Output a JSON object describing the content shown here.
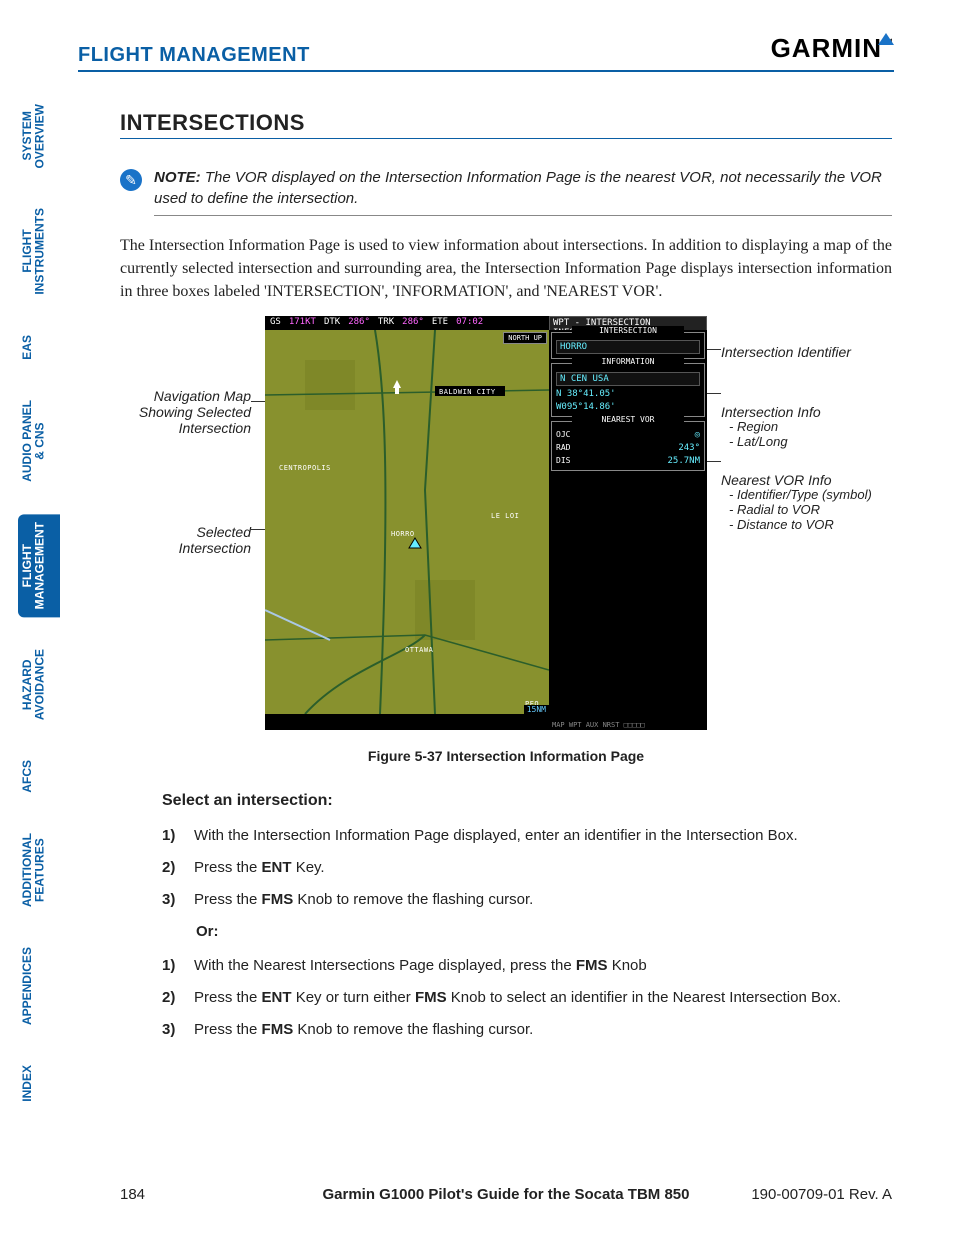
{
  "header": {
    "section": "FLIGHT MANAGEMENT",
    "brand": "GARMIN",
    "tm": "™"
  },
  "tabs": [
    {
      "label": "SYSTEM\nOVERVIEW",
      "active": false
    },
    {
      "label": "FLIGHT\nINSTRUMENTS",
      "active": false
    },
    {
      "label": "EAS",
      "active": false
    },
    {
      "label": "AUDIO PANEL\n& CNS",
      "active": false
    },
    {
      "label": "FLIGHT\nMANAGEMENT",
      "active": true
    },
    {
      "label": "HAZARD\nAVOIDANCE",
      "active": false
    },
    {
      "label": "AFCS",
      "active": false
    },
    {
      "label": "ADDITIONAL\nFEATURES",
      "active": false
    },
    {
      "label": "APPENDICES",
      "active": false
    },
    {
      "label": "INDEX",
      "active": false
    }
  ],
  "heading": "INTERSECTIONS",
  "note": {
    "label": "NOTE:",
    "text": " The VOR displayed on the Intersection Information Page is the nearest VOR, not necessarily the VOR used to define the intersection."
  },
  "paragraph": "The Intersection Information Page is used to view information about intersections.  In addition to displaying a map of the currently selected intersection and surrounding area, the Intersection Information Page displays intersection information in three boxes labeled 'INTERSECTION', 'INFORMATION', and 'NEAREST VOR'.",
  "figure": {
    "callouts_left": {
      "nav": "Navigation Map\nShowing Selected\nIntersection",
      "sel": "Selected Intersection"
    },
    "callouts_right": {
      "ident": "Intersection Identifier",
      "info_title": "Intersection Info",
      "info_sub": "- Region\n- Lat/Long",
      "vor_title": "Nearest VOR Info",
      "vor_sub": "- Identifier/Type (symbol)\n- Radial to VOR\n- Distance to VOR"
    },
    "mfd": {
      "top": {
        "gs_label": "GS",
        "gs": "171KT",
        "dtk_label": "DTK",
        "dtk": "286°",
        "trk_label": "TRK",
        "trk": "286°",
        "ete_label": "ETE",
        "ete": "07:02"
      },
      "page_title": "WPT - INTERSECTION INFORMATION",
      "north_up": "NORTH UP",
      "zoom": "15NM",
      "waypoints": {
        "baldwin": "BALDWIN CITY",
        "centropolis": "CENTROPOLIS",
        "horro": "HORRO",
        "leloi": "LE LOI",
        "ottawa": "OTTAWA",
        "peq": "PEQ"
      },
      "boxes": {
        "intersection": {
          "title": "INTERSECTION",
          "value": "HORRO"
        },
        "information": {
          "title": "INFORMATION",
          "region": "N CEN USA",
          "lat": "N 38°41.05'",
          "lon": "W095°14.86'"
        },
        "nearest_vor": {
          "title": "NEAREST VOR",
          "id": "OJC",
          "rad_label": "RAD",
          "rad": "243°",
          "dis_label": "DIS",
          "dis": "25.7NM"
        }
      },
      "bottom_bar": "MAP  WPT  AUX NRST  □□□□□"
    },
    "caption": "Figure 5-37  Intersection Information Page"
  },
  "procedure": {
    "title": "Select an intersection:",
    "steps_a": [
      {
        "n": "1)",
        "t": "With the Intersection Information Page displayed, enter an identifier in the Intersection Box."
      },
      {
        "n": "2)",
        "t": "Press the <b>ENT</b> Key."
      },
      {
        "n": "3)",
        "t": "Press the <b>FMS</b> Knob to remove the flashing cursor."
      }
    ],
    "or": "Or:",
    "steps_b": [
      {
        "n": "1)",
        "t": "With the Nearest Intersections Page displayed, press the <b>FMS</b> Knob"
      },
      {
        "n": "2)",
        "t": "Press the <b>ENT</b> Key or turn either <b>FMS</b> Knob to select an identifier in the Nearest Intersection Box."
      },
      {
        "n": "3)",
        "t": "Press the <b>FMS</b> Knob to remove the flashing cursor."
      }
    ]
  },
  "footer": {
    "page": "184",
    "center": "Garmin G1000 Pilot's Guide for the Socata TBM 850",
    "rev": "190-00709-01  Rev. A"
  }
}
